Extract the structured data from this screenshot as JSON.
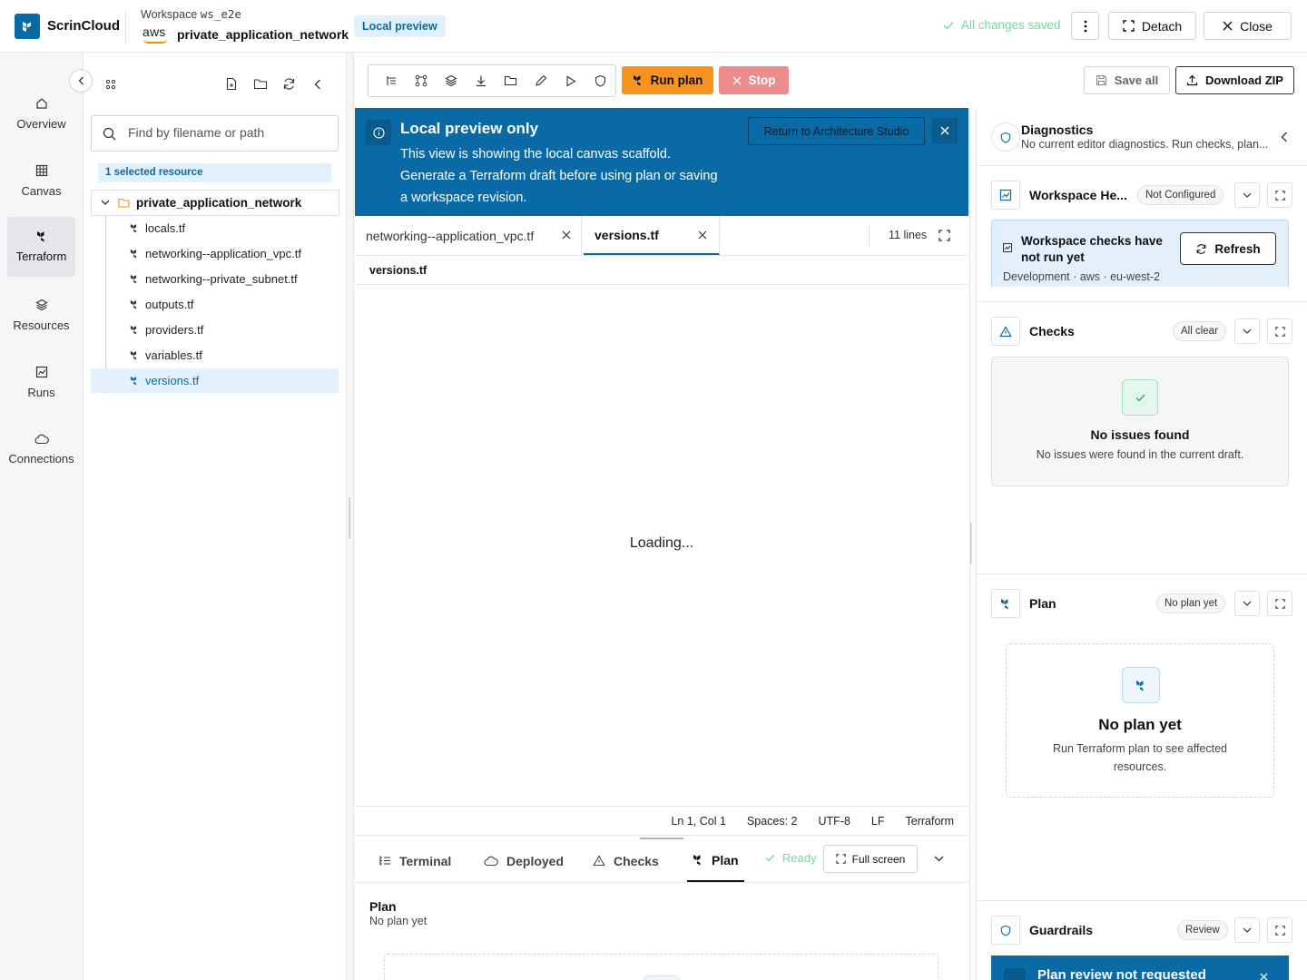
{
  "app": {
    "brand": "ScrinCloud",
    "workspace_label": "Workspace",
    "workspace_id": "ws_e2e",
    "provider": "aws",
    "project": "private_application_network",
    "mode_badge": "Local preview",
    "saved_status": "All changes saved",
    "detach_label": "Detach",
    "close_label": "Close"
  },
  "nav": {
    "items": [
      {
        "label": "Overview",
        "icon": "home-icon"
      },
      {
        "label": "Canvas",
        "icon": "grid-icon"
      },
      {
        "label": "Terraform",
        "icon": "terraform-icon"
      },
      {
        "label": "Resources",
        "icon": "layers-icon"
      },
      {
        "label": "Runs",
        "icon": "chart-icon"
      },
      {
        "label": "Connections",
        "icon": "cloud-icon"
      }
    ],
    "active": "Terraform"
  },
  "explorer": {
    "search_placeholder": "Find by filename or path",
    "selection_badge": "1 selected resource",
    "folder": "private_application_network",
    "files": [
      "locals.tf",
      "networking--application_vpc.tf",
      "networking--private_subnet.tf",
      "outputs.tf",
      "providers.tf",
      "variables.tf",
      "versions.tf"
    ],
    "active_file": "versions.tf"
  },
  "toolbar": {
    "run_label": "Run plan",
    "stop_label": "Stop",
    "save_all_label": "Save all",
    "download_label": "Download ZIP"
  },
  "banner": {
    "title": "Local preview only",
    "line1": "This view is showing the local canvas scaffold.",
    "line2": "Generate a Terraform draft before using plan or saving",
    "line3": "a workspace revision.",
    "return_label": "Return to Architecture Studio"
  },
  "editor": {
    "tabs": [
      {
        "label": "networking--application_vpc.tf",
        "active": false
      },
      {
        "label": "versions.tf",
        "active": true
      }
    ],
    "line_count": "11 lines",
    "path": "versions.tf",
    "loading": "Loading...",
    "status": {
      "position": "Ln 1, Col 1",
      "indent": "Spaces: 2",
      "encoding": "UTF-8",
      "eol": "LF",
      "language": "Terraform"
    }
  },
  "bottom": {
    "tabs": [
      "Terminal",
      "Deployed",
      "Checks",
      "Plan"
    ],
    "active_tab": "Plan",
    "ready": "Ready",
    "fullscreen_label": "Full screen",
    "plan_title": "Plan",
    "plan_sub": "No plan yet"
  },
  "diagnostics": {
    "title": "Diagnostics",
    "subtitle": "No current editor diagnostics. Run checks, plan..."
  },
  "health": {
    "title": "Workspace He...",
    "chip": "Not Configured",
    "card_title": "Workspace checks have not run yet",
    "card_meta": "Development · aws · eu-west-2",
    "refresh_label": "Refresh"
  },
  "checks": {
    "title": "Checks",
    "chip": "All clear",
    "empty_title": "No issues found",
    "empty_sub": "No issues were found in the current draft."
  },
  "plan": {
    "title": "Plan",
    "chip": "No plan yet",
    "empty_title": "No plan yet",
    "empty_sub": "Run Terraform plan to see affected resources."
  },
  "guardrails": {
    "title": "Guardrails",
    "chip": "Review",
    "banner": "Plan review not requested"
  },
  "colors": {
    "brand": "#0a6aa6",
    "run": "#f7931e",
    "stop": "#ed8c8c",
    "success": "#76d6a5"
  }
}
